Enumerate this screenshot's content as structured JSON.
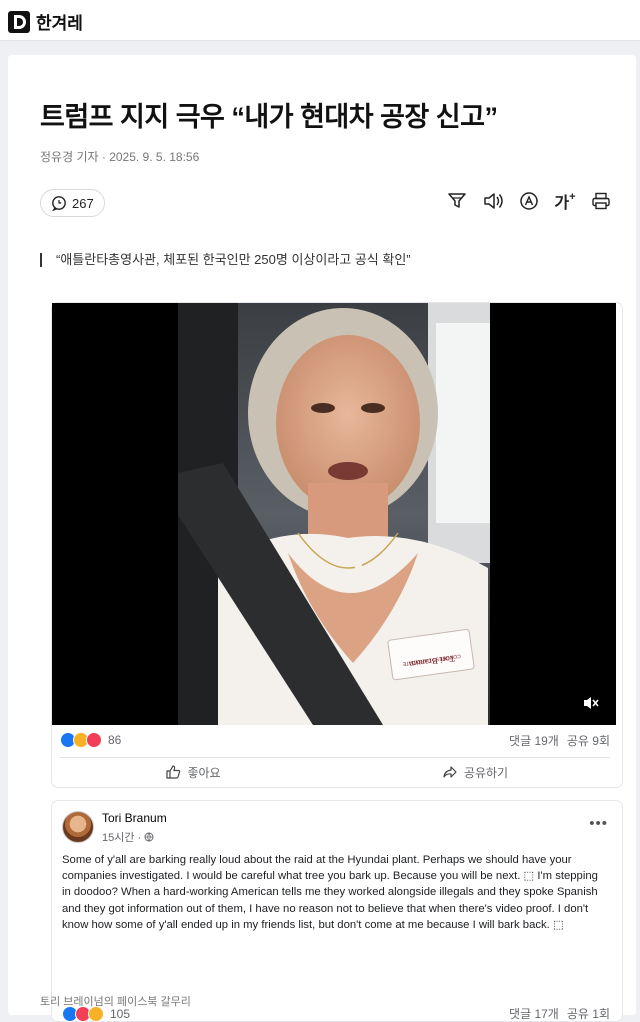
{
  "brand": {
    "name": "한겨레"
  },
  "article": {
    "headline": "트럼프 지지 극우 “내가 현대차 공장 신고”",
    "byline": "정유경 기자 · 2025. 9. 5. 18:56",
    "comment_count": "267",
    "quote": "“애틀란타총영사관, 체포된 한국인만 250명 이상이라고 공식 확인”",
    "photo_caption": "토리 브레이넘의 페이스북 갈무리"
  },
  "toolbar": {
    "icons": [
      "filter-icon",
      "audio-icon",
      "translate-icon",
      "font-size-icon",
      "print-icon"
    ],
    "font_label": "가"
  },
  "video_post": {
    "reaction_count": "86",
    "comments": "댓글 19개",
    "shares": "공유 9회",
    "like_label": "좋아요",
    "share_label": "공유하기",
    "badge_line1": "Tori Branum",
    "badge_line2": "CONGRESS CANDIDATE"
  },
  "text_post": {
    "author": "Tori Branum",
    "time": "15시간 ·",
    "body": "Some of y'all are barking really loud about the raid at the Hyundai plant. Perhaps we should have your companies investigated. I would be careful what tree you bark up. Because you will be next. ⬚ I'm stepping in doodoo? When a hard-working American tells me they worked alongside illegals and they spoke Spanish and they got information out of them, I have no reason not to believe that when there's video proof. I don't know how some of y'all ended up in my friends list, but don't come at me because I will bark back. ⬚",
    "reaction_count": "105",
    "comments": "댓글 17개",
    "shares": "공유 1회"
  },
  "colors": {
    "fb_like": "#1877f2",
    "fb_love": "#f33e58",
    "fb_haha": "#f7b125"
  }
}
